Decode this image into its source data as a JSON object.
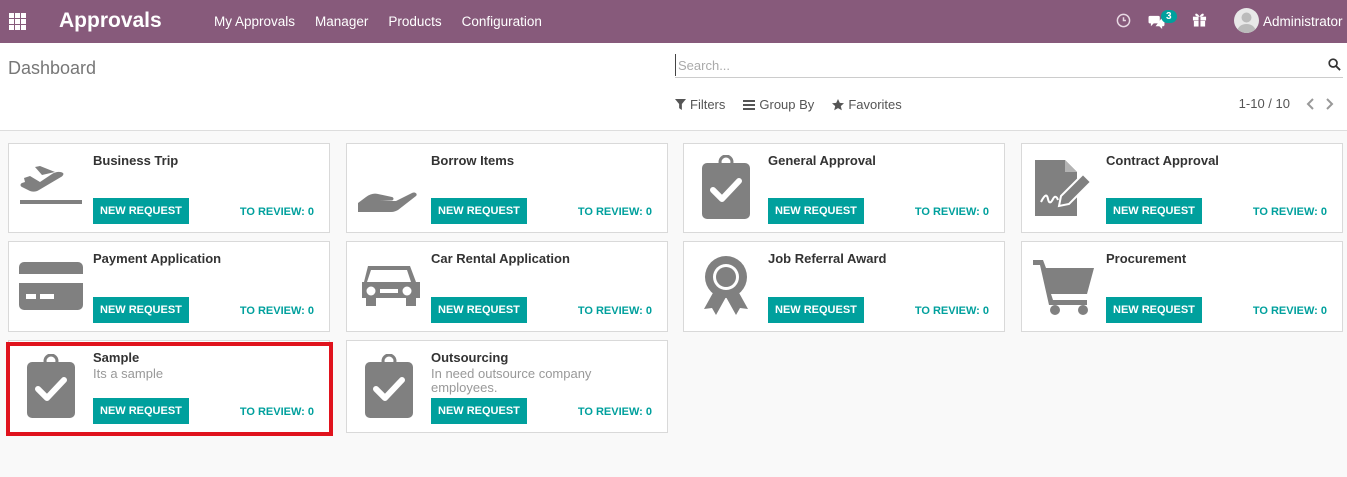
{
  "navbar": {
    "brand": "Approvals",
    "menu": [
      "My Approvals",
      "Manager",
      "Products",
      "Configuration"
    ],
    "message_count": "3",
    "user": "Administrator",
    "color": "#875a7b"
  },
  "control_panel": {
    "title": "Dashboard",
    "search_placeholder": "Search...",
    "filters_label": "Filters",
    "groupby_label": "Group By",
    "favorites_label": "Favorites",
    "pager": "1-10 / 10"
  },
  "accent_color": "#00a09d",
  "cards": [
    {
      "title": "Business Trip",
      "description": "",
      "icon": "plane-icon",
      "new_request": "NEW REQUEST",
      "to_review": "TO REVIEW: 0"
    },
    {
      "title": "Borrow Items",
      "description": "",
      "icon": "hand-icon",
      "new_request": "NEW REQUEST",
      "to_review": "TO REVIEW: 0"
    },
    {
      "title": "General Approval",
      "description": "",
      "icon": "clipboard-check-icon",
      "new_request": "NEW REQUEST",
      "to_review": "TO REVIEW: 0"
    },
    {
      "title": "Contract Approval",
      "description": "",
      "icon": "contract-sign-icon",
      "new_request": "NEW REQUEST",
      "to_review": "TO REVIEW: 0"
    },
    {
      "title": "Payment Application",
      "description": "",
      "icon": "credit-card-icon",
      "new_request": "NEW REQUEST",
      "to_review": "TO REVIEW: 0"
    },
    {
      "title": "Car Rental Application",
      "description": "",
      "icon": "car-icon",
      "new_request": "NEW REQUEST",
      "to_review": "TO REVIEW: 0"
    },
    {
      "title": "Job Referral Award",
      "description": "",
      "icon": "award-icon",
      "new_request": "NEW REQUEST",
      "to_review": "TO REVIEW: 0"
    },
    {
      "title": "Procurement",
      "description": "",
      "icon": "shopping-cart-icon",
      "new_request": "NEW REQUEST",
      "to_review": "TO REVIEW: 0"
    },
    {
      "title": "Sample",
      "description": "Its a sample",
      "icon": "clipboard-check-icon",
      "new_request": "NEW REQUEST",
      "to_review": "TO REVIEW: 0"
    },
    {
      "title": "Outsourcing",
      "description": "In need outsource company employees.",
      "icon": "clipboard-check-icon",
      "new_request": "NEW REQUEST",
      "to_review": "TO REVIEW: 0"
    }
  ],
  "highlight_color": "#e0131d"
}
